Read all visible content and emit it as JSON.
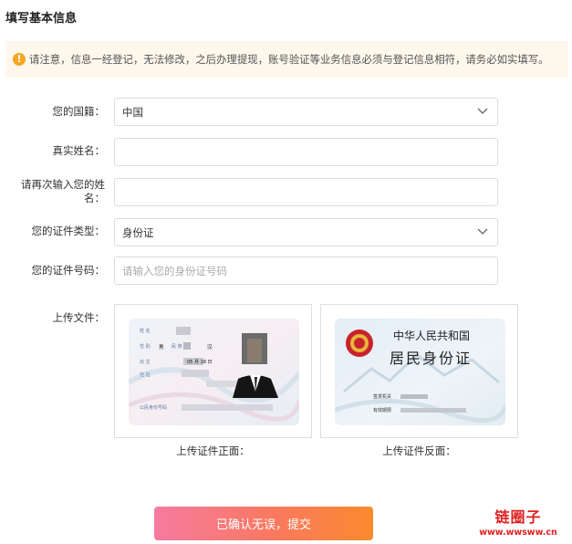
{
  "header": {
    "title": "填写基本信息"
  },
  "notice": {
    "icon": "warning-icon",
    "text": "请注意，信息一经登记，无法修改，之后办理提现，账号验证等业务信息必须与登记信息相符，请务必如实填写。"
  },
  "form": {
    "nationality": {
      "label": "您的国籍：",
      "value": "中国"
    },
    "real_name": {
      "label": "真实姓名：",
      "value": ""
    },
    "confirm_name": {
      "label_line1": "请再次输入您的姓",
      "label_line2": "名：",
      "value": ""
    },
    "id_type": {
      "label": "您的证件类型：",
      "value": "身份证"
    },
    "id_number": {
      "label": "您的证件号码：",
      "placeholder": "请输入您的身份证号码"
    },
    "upload": {
      "label": "上传文件：",
      "front_caption": "上传证件正面：",
      "back_caption": "上传证件反面：",
      "front_card": {
        "name_key": "姓 名",
        "sex_key": "性 别",
        "sex": "男",
        "ethnic_key": "民 族",
        "ethnic": "汉",
        "birth_key": "出 生",
        "birth_md": "05 月 18 日",
        "addr_key": "住 址",
        "id_key": "公民身份号码"
      },
      "back_card": {
        "country": "中华人民共和国",
        "title": "居民身份证",
        "authority_key": "签发机关",
        "validity_key": "有效期限"
      }
    }
  },
  "submit": {
    "label": "已确认无误，提交"
  },
  "watermark": {
    "line1": "链圈子",
    "line2": "www.wwsww.cn"
  },
  "colors": {
    "accent_start": "#f77aa0",
    "accent_end": "#fb8a2d",
    "notice_bg": "#fdf7ec",
    "warn": "#f5a623"
  }
}
